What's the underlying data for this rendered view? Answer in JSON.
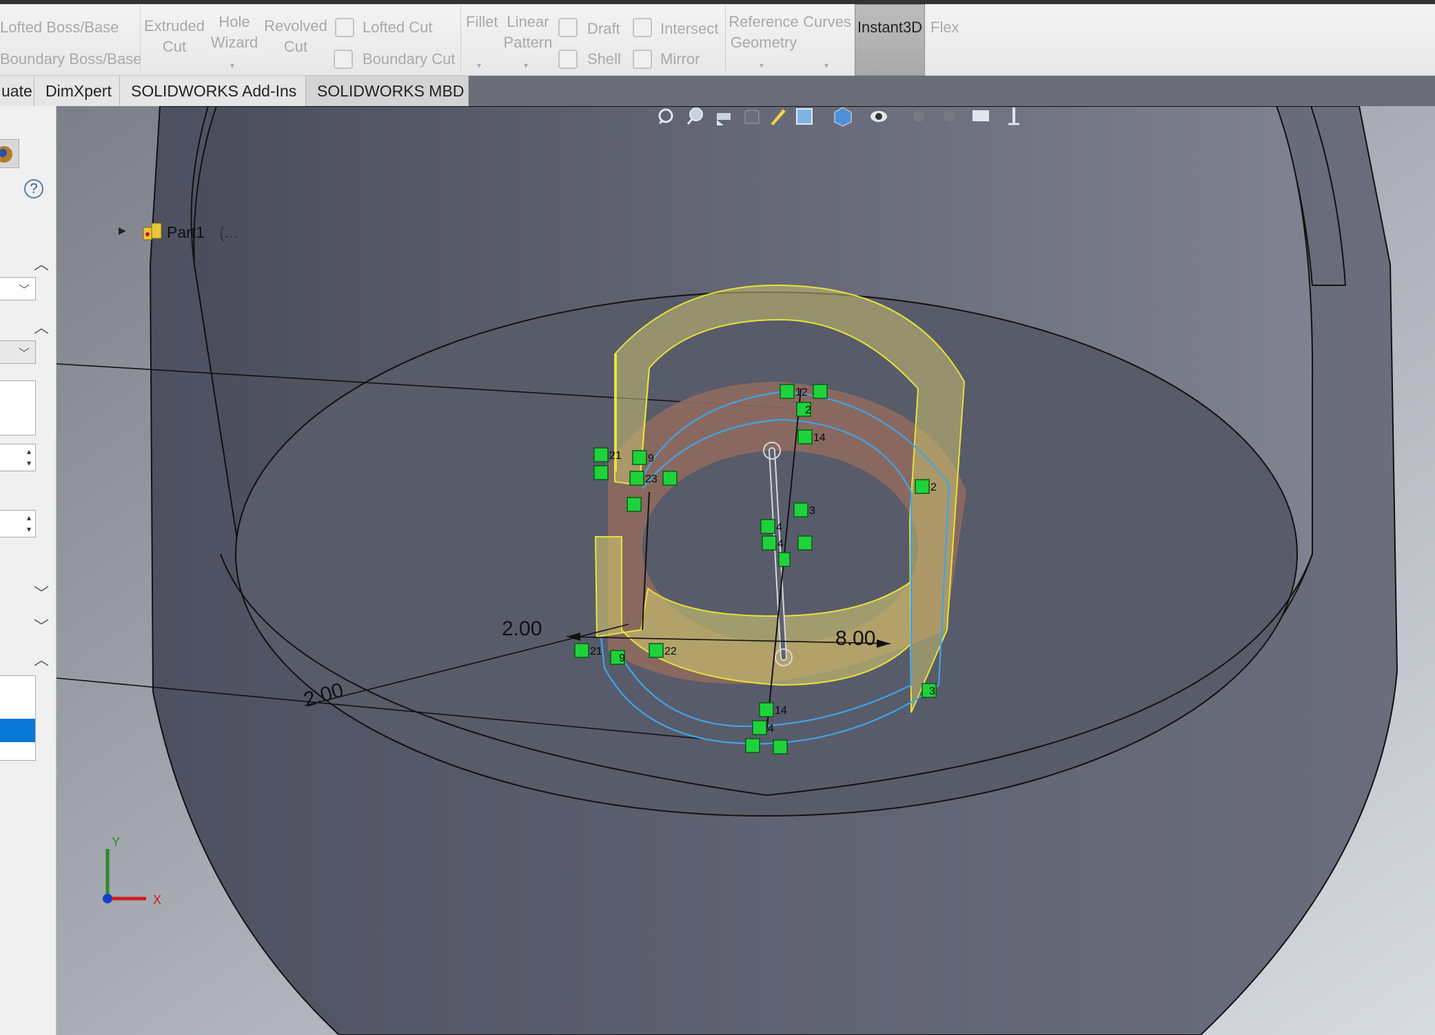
{
  "ribbon": {
    "lofted_boss": "Lofted Boss/Base",
    "boundary_boss": "Boundary Boss/Base",
    "extruded_cut_1": "Extruded",
    "extruded_cut_2": "Cut",
    "hole_wizard_1": "Hole",
    "hole_wizard_2": "Wizard",
    "revolved_cut_1": "Revolved",
    "revolved_cut_2": "Cut",
    "lofted_cut": "Lofted Cut",
    "boundary_cut": "Boundary Cut",
    "fillet": "Fillet",
    "linear_pattern_1": "Linear",
    "linear_pattern_2": "Pattern",
    "draft": "Draft",
    "intersect": "Intersect",
    "shell": "Shell",
    "mirror": "Mirror",
    "reference_geometry_1": "Reference",
    "reference_geometry_2": "Geometry",
    "curves": "Curves",
    "instant3d": "Instant3D",
    "flex": "Flex"
  },
  "tabs": [
    {
      "label": "uate"
    },
    {
      "label": "DimXpert"
    },
    {
      "label": "SOLIDWORKS Add-Ins"
    },
    {
      "label": "SOLIDWORKS MBD"
    }
  ],
  "tree": {
    "part_name": "Part1",
    "suffix": "(..."
  },
  "left_panel": {
    "help_symbol": "?"
  },
  "dimensions": {
    "d1": "2.00",
    "d2": "8.00",
    "d3": "2.00"
  },
  "triad": {
    "x": "X",
    "y": "Y"
  },
  "relations": [
    "12",
    "2",
    "14",
    "21",
    "9",
    "23",
    "22",
    "3",
    "2",
    "4",
    "4",
    "21",
    "9",
    "22",
    "14",
    "4",
    "3",
    "2"
  ],
  "colors": {
    "model_body": "#5d6070",
    "sketch_fill": "#c9c070",
    "sketch_face": "#8f6a5e",
    "relation_green": "#1fd23c",
    "edge_blue": "#3fa4e8"
  },
  "icons": [
    "zoom-to-fit-icon",
    "zoom-area-icon",
    "previous-view-icon",
    "section-view-icon",
    "view-orientation-icon",
    "display-style-icon",
    "hide-show-icon",
    "edit-appearance-icon",
    "apply-scene-icon",
    "view-settings-icon"
  ]
}
